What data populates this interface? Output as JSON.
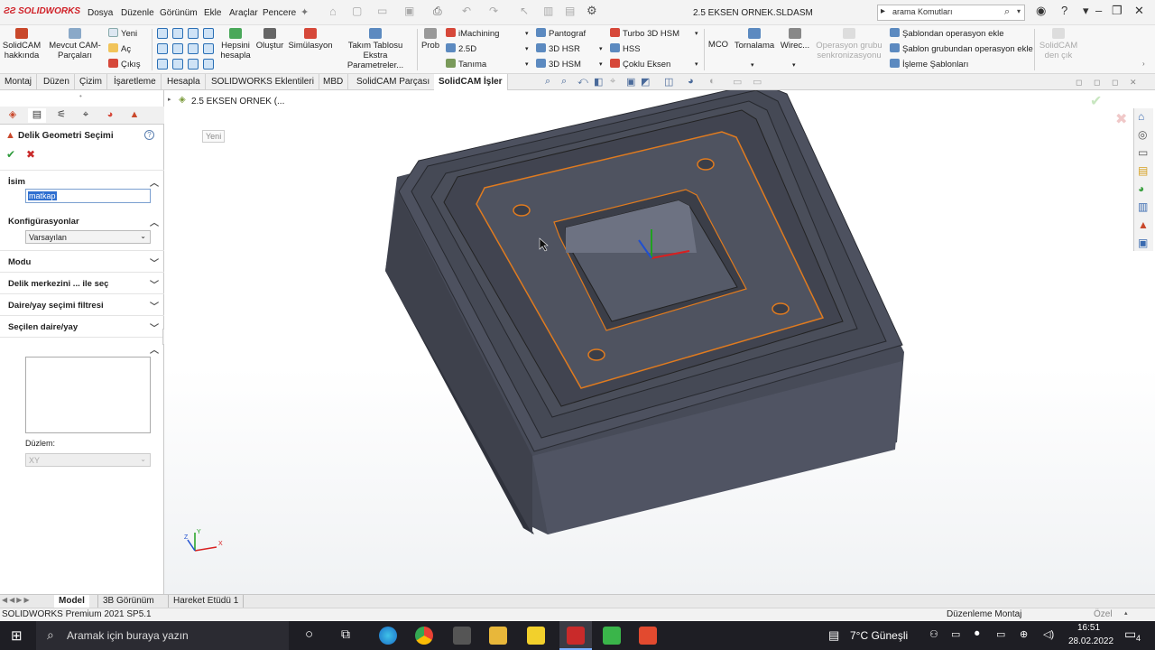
{
  "app": {
    "logo": "SOLIDWORKS",
    "doc_title": "2.5 EKSEN ORNEK.SLDASM"
  },
  "menu": [
    "Dosya",
    "Düzenle",
    "Görünüm",
    "Ekle",
    "Araçlar",
    "Pencere"
  ],
  "search": {
    "value": "arama Komutları"
  },
  "ribbon": {
    "about": "SolidCAM hakkında",
    "existing": "Mevcut CAM-Parçaları",
    "new": "Yeni",
    "open": "Aç",
    "exit": "Çıkış",
    "calculate": "Hepsini hesapla",
    "create": "Oluştur",
    "simulate": "Simülasyon",
    "tool_table": "Takım Tablosu Ekstra Parametreler...",
    "prob": "Prob",
    "imachining": "iMachining",
    "d25": "2.5D",
    "define": "Tanıma",
    "pantograph": "Pantograf",
    "hsr": "3D HSR",
    "hsm3d": "3D HSM",
    "turbo": "Turbo 3D HSM",
    "hss": "HSS",
    "multiaxis": "Çoklu Eksen",
    "mco": "MCO",
    "turning": "Tornalama",
    "wire": "Wirec...",
    "op_sync": "Operasyon grubu senkronizasyonu",
    "template_op": "Şablondan operasyon ekle",
    "template_group": "Şablon grubundan operasyon ekle",
    "process_templates": "İşleme Şablonları",
    "exit_cam": "SolidCAM den çık"
  },
  "tabs": [
    "Montaj",
    "Düzen",
    "Çizim",
    "İşaretleme",
    "Hesapla",
    "SOLIDWORKS Eklentileri",
    "MBD",
    "SolidCAM Parçası",
    "SolidCAM İşler"
  ],
  "tree": {
    "root": "2.5 EKSEN ORNEK  (..."
  },
  "viewport": {
    "new_label": "Yeni",
    "triad_x": "X",
    "triad_y": "Y",
    "triad_z": "Z"
  },
  "panel": {
    "title": "Delik Geometri Seçimi",
    "name_section": "İsim",
    "name_value": "matkap",
    "config_section": "Konfigürasyonlar",
    "config_value": "Varsayılan",
    "mode_section": "Modu",
    "center_section": "Delik merkezini ... ile seç",
    "filter_section": "Daire/yay seçimi filtresi",
    "selected_section": "Seçilen daire/yay",
    "plane_label": "Düzlem:",
    "plane_value": "XY"
  },
  "bottom_tabs": [
    "Model",
    "3B Görünüm",
    "Hareket Etüdü 1"
  ],
  "status": {
    "left": "SOLIDWORKS Premium 2021 SP5.1",
    "mode": "Düzenleme Montaj",
    "custom": "Özel"
  },
  "taskbar": {
    "search": "Aramak için buraya yazın",
    "weather": "7°C  Güneşli",
    "time": "16:51",
    "date": "28.02.2022",
    "notif": "4"
  },
  "colors": {
    "accent": "#d01f26",
    "selection": "#e07b1f",
    "part": "#4a4e5a"
  }
}
